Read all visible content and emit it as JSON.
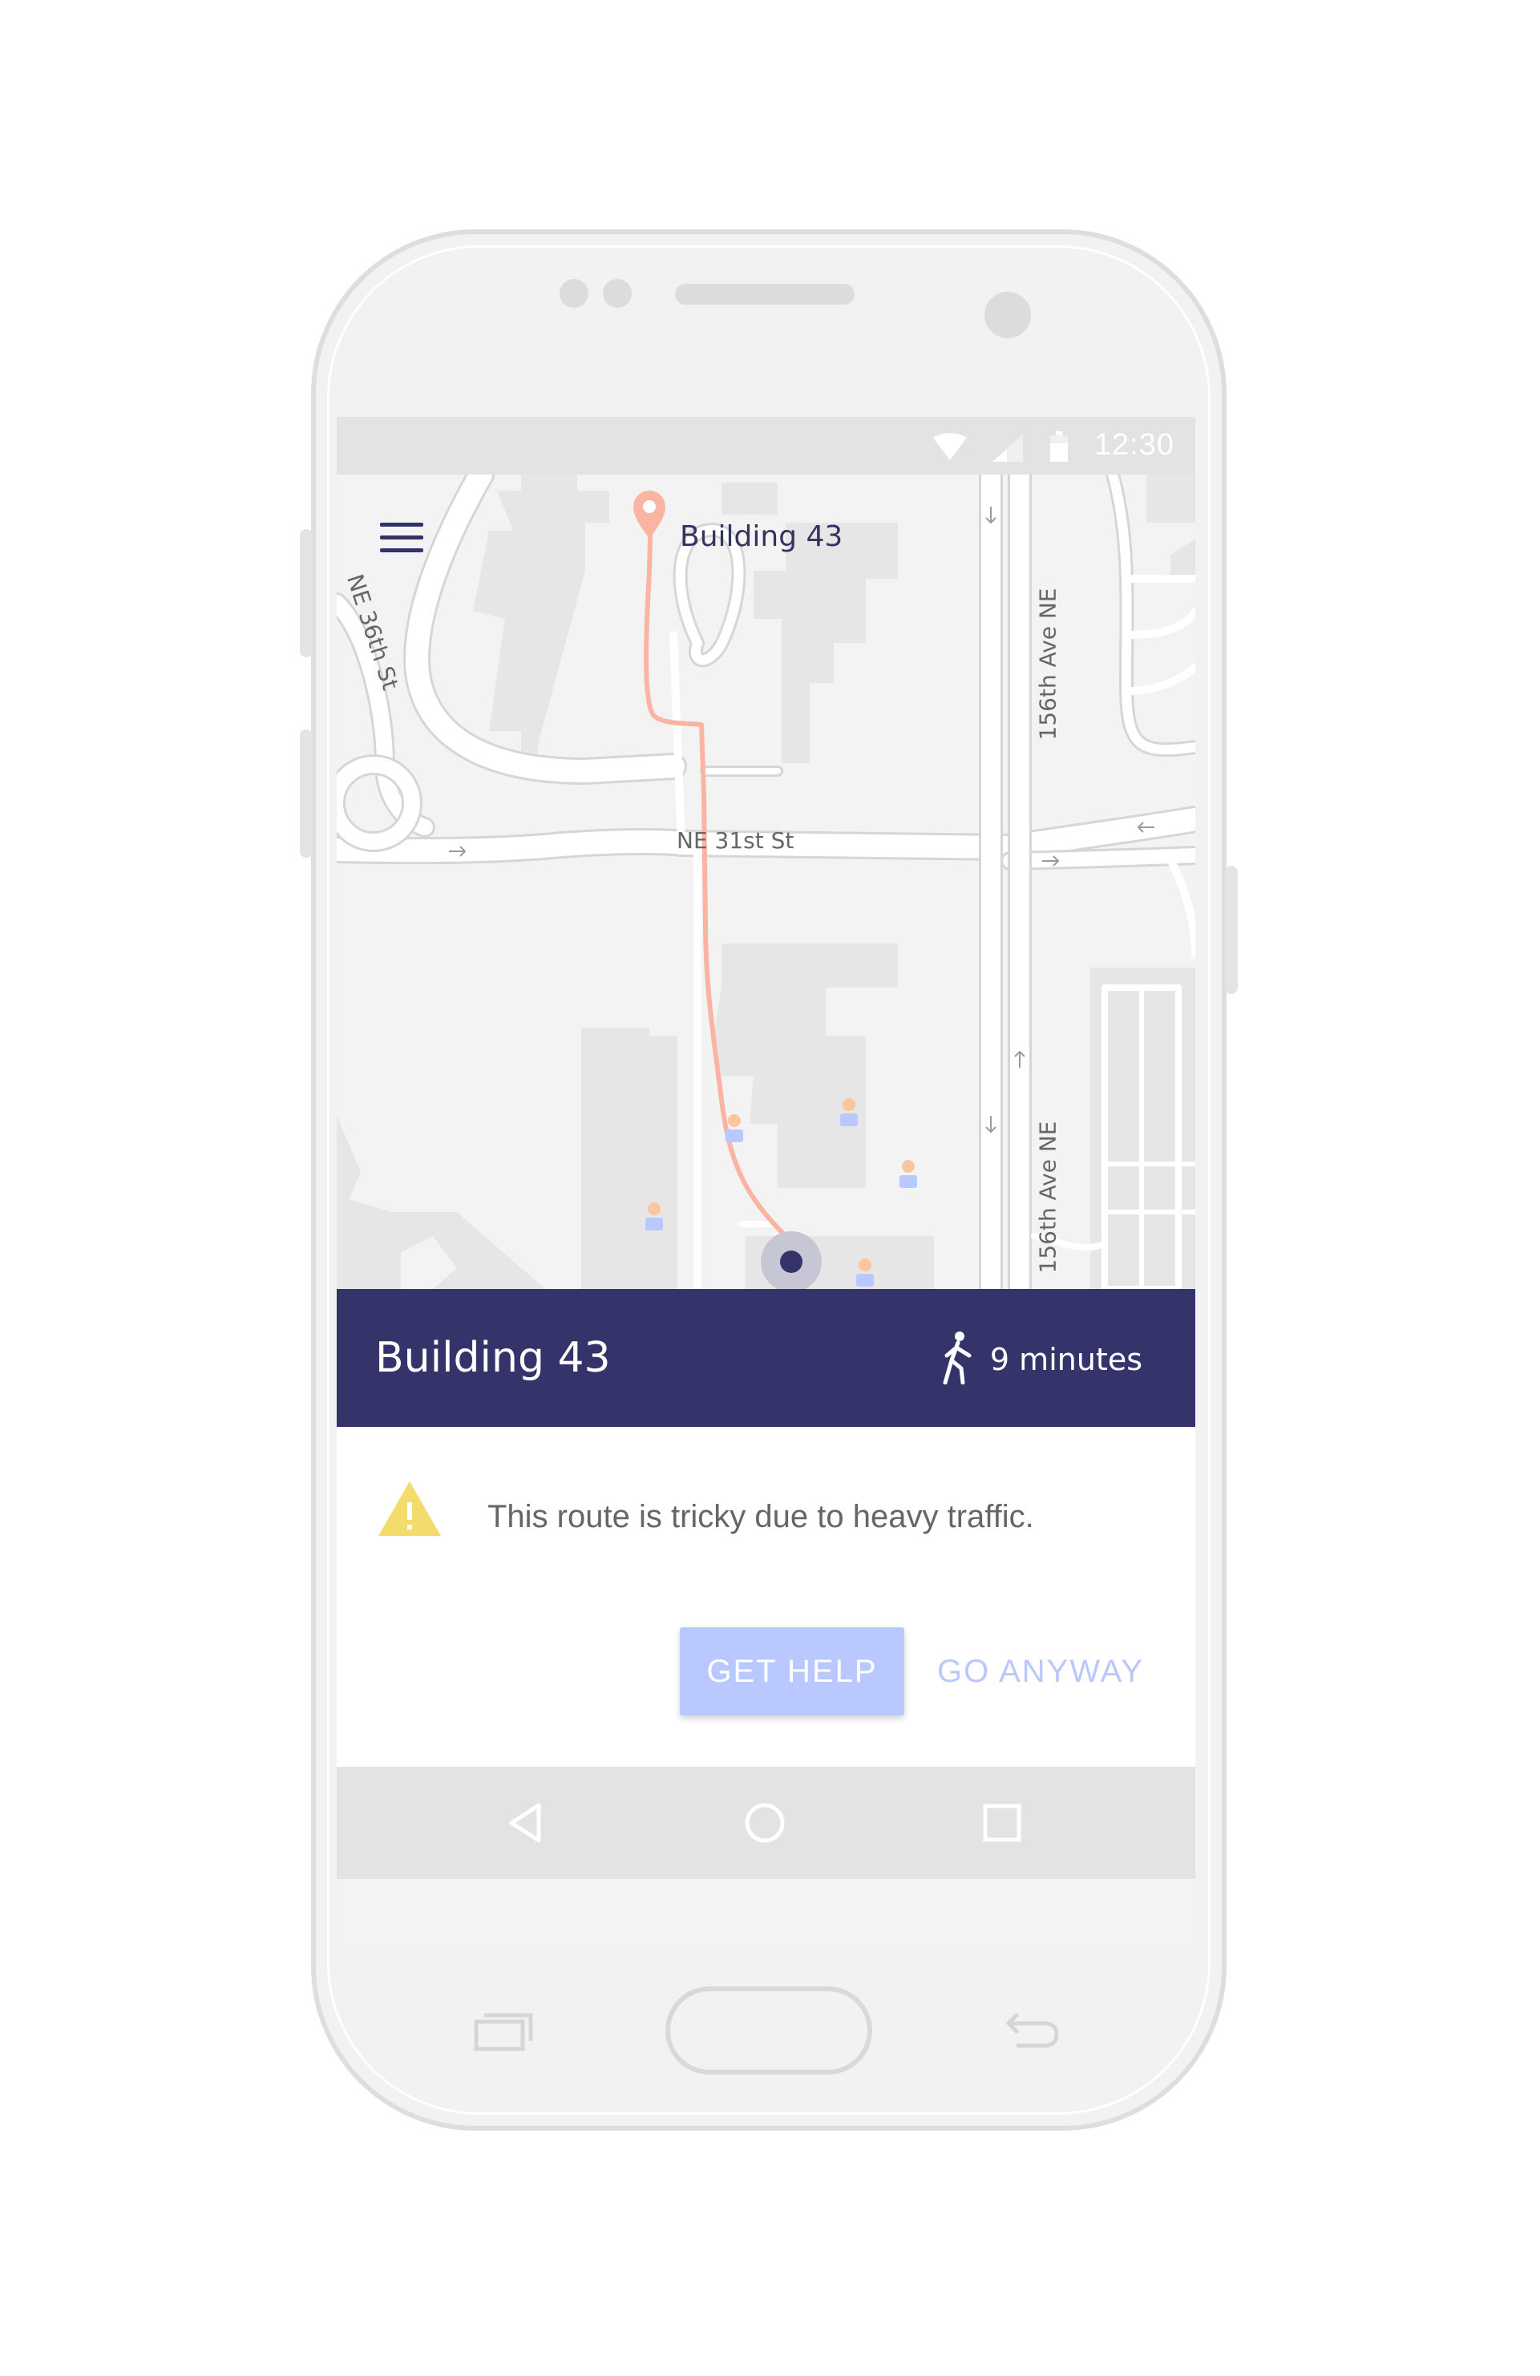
{
  "status_bar": {
    "time": "12:30"
  },
  "map": {
    "destination_label": "Building 43",
    "road_labels": {
      "ne_36th": "NE 36th St",
      "ne_31st": "NE 31st St",
      "ave_156th_upper": "156th Ave NE",
      "ave_156th_lower": "156th Ave NE"
    },
    "route_color": "#fbb4a2",
    "current_location_color": "#35346a"
  },
  "card": {
    "title": "Building 43",
    "eta": "9 minutes",
    "eta_icon": "walking-person-icon",
    "header_color": "#35346a",
    "warning_icon": "warning-triangle-icon",
    "warning_color": "#f3dc6b",
    "message": "This route is tricky due to heavy traffic.",
    "primary_button": "GET HELP",
    "secondary_button": "GO ANYWAY",
    "accent_color": "#b9c9ff"
  },
  "nav_bar": {
    "back": "back-triangle-icon",
    "home": "home-circle-icon",
    "recents": "recents-square-icon"
  }
}
